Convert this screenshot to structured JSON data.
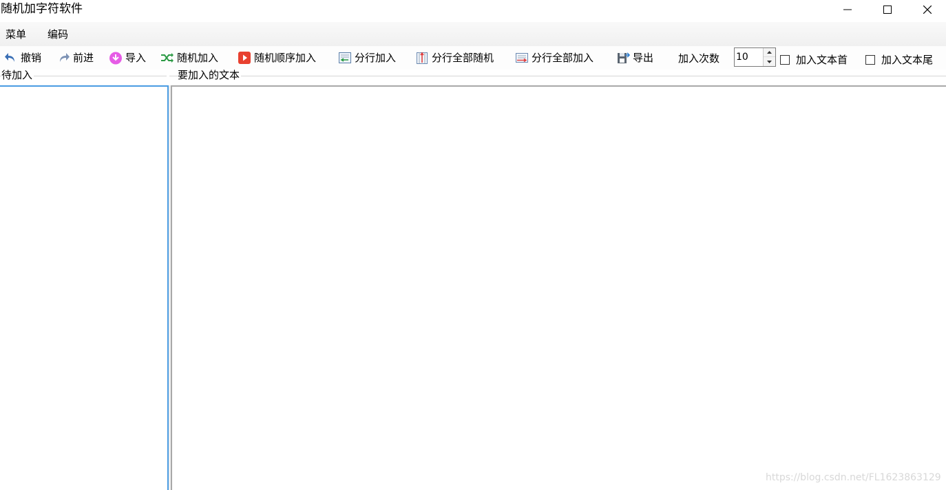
{
  "window": {
    "title": "随机加字符软件"
  },
  "menubar": {
    "items": [
      {
        "label": "菜单"
      },
      {
        "label": "编码"
      }
    ]
  },
  "toolbar": {
    "buttons": [
      {
        "label": "撤销",
        "icon": "undo-icon"
      },
      {
        "label": "前进",
        "icon": "redo-icon"
      },
      {
        "label": "导入",
        "icon": "import-icon"
      },
      {
        "label": "随机加入",
        "icon": "shuffle-icon"
      },
      {
        "label": "随机顺序加入",
        "icon": "play-icon"
      },
      {
        "label": "分行加入",
        "icon": "line-insert-icon"
      },
      {
        "label": "分行全部随机",
        "icon": "line-random-icon"
      },
      {
        "label": "分行全部加入",
        "icon": "line-all-icon"
      },
      {
        "label": "导出",
        "icon": "export-icon"
      }
    ],
    "count_label": "加入次数",
    "count_value": "10",
    "checkboxes": [
      {
        "label": "加入文本首",
        "checked": false
      },
      {
        "label": "加入文本尾",
        "checked": false
      }
    ]
  },
  "panels": {
    "left_label": "待加入",
    "right_label": "要加入的文本"
  },
  "watermark": "https://blog.csdn.net/FL1623863129",
  "colors": {
    "focus_border": "#4a9be2",
    "import_icon": "#e65ce6",
    "play_icon": "#e8402f",
    "undo_icon": "#3a6fb5",
    "shuffle_icon": "#2c9a45"
  }
}
